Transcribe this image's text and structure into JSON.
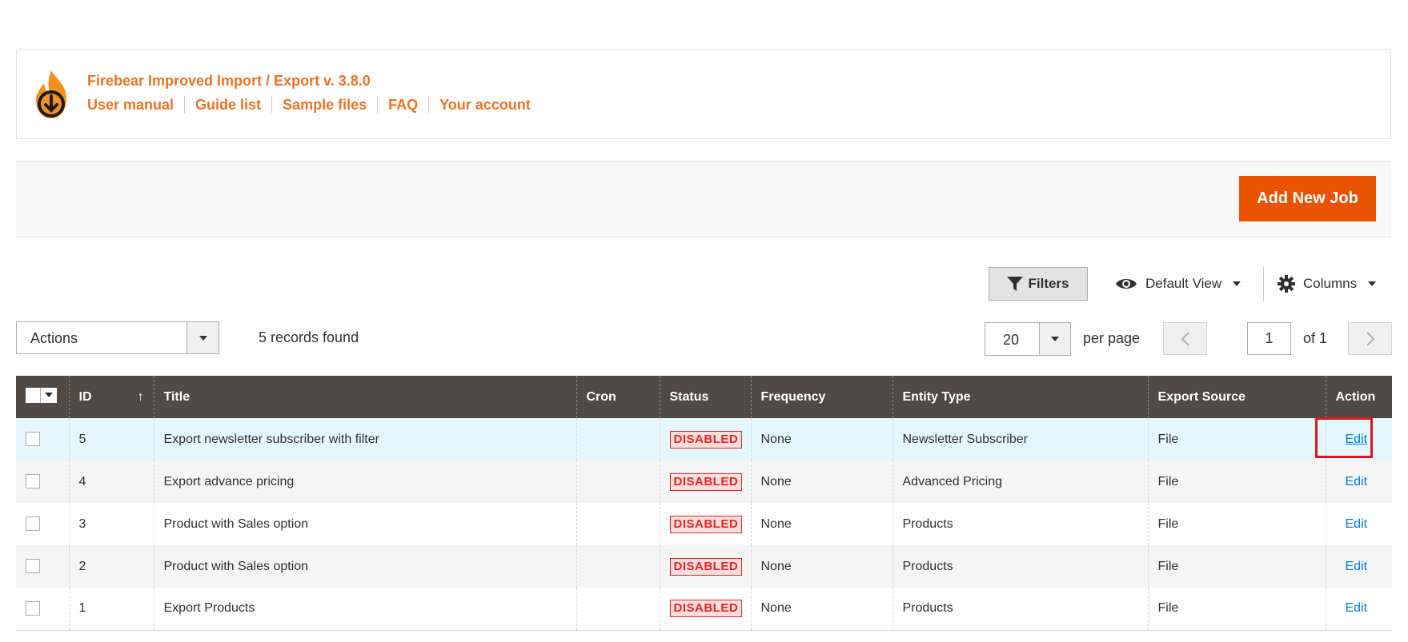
{
  "header": {
    "title": "Firebear Improved Import / Export v. 3.8.0",
    "links": [
      "User manual",
      "Guide list",
      "Sample files",
      "FAQ",
      "Your account"
    ]
  },
  "page_actions": {
    "add_new_job": "Add New Job"
  },
  "toolbar": {
    "filters": "Filters",
    "view": "Default View",
    "columns": "Columns",
    "mass_actions": "Actions",
    "records_found": "5 records found",
    "per_page_value": "20",
    "per_page_label": "per page",
    "current_page": "1",
    "of_pages": "of 1"
  },
  "grid": {
    "columns": [
      "ID",
      "Title",
      "Cron",
      "Status",
      "Frequency",
      "Entity Type",
      "Export Source",
      "Action"
    ],
    "sort_indicator": "↑",
    "rows": [
      {
        "id": "5",
        "title": "Export newsletter subscriber with filter",
        "cron": "",
        "status": "DISABLED",
        "frequency": "None",
        "entity_type": "Newsletter Subscriber",
        "export_source": "File",
        "action": "Edit"
      },
      {
        "id": "4",
        "title": "Export advance pricing",
        "cron": "",
        "status": "DISABLED",
        "frequency": "None",
        "entity_type": "Advanced Pricing",
        "export_source": "File",
        "action": "Edit"
      },
      {
        "id": "3",
        "title": "Product with Sales option",
        "cron": "",
        "status": "DISABLED",
        "frequency": "None",
        "entity_type": "Products",
        "export_source": "File",
        "action": "Edit"
      },
      {
        "id": "2",
        "title": "Product with Sales option",
        "cron": "",
        "status": "DISABLED",
        "frequency": "None",
        "entity_type": "Products",
        "export_source": "File",
        "action": "Edit"
      },
      {
        "id": "1",
        "title": "Export Products",
        "cron": "",
        "status": "DISABLED",
        "frequency": "None",
        "entity_type": "Products",
        "export_source": "File",
        "action": "Edit"
      }
    ]
  },
  "colors": {
    "brand_orange": "#eb7326",
    "button_orange": "#eb5202",
    "grid_header": "#514943",
    "status_red": "#e22626",
    "link_blue": "#007bdb",
    "highlight_row": "#e5f7fe"
  },
  "icons": [
    "firebear-logo-icon",
    "filter-icon",
    "eye-icon",
    "gear-icon",
    "chevron-left-icon",
    "chevron-right-icon",
    "sort-up-icon"
  ]
}
